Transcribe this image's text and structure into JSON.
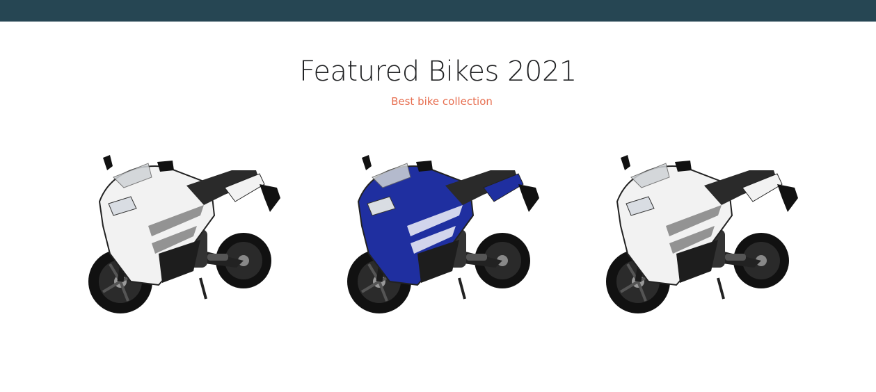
{
  "header": {
    "bar_color": "#264653"
  },
  "section": {
    "title": "Featured Bikes 2021",
    "subtitle": "Best bike collection",
    "subtitle_color": "#e76f51"
  },
  "bikes": [
    {
      "name": "bike-white",
      "accent": "#f2f2f2",
      "decal": "#7a7a7a"
    },
    {
      "name": "bike-blue",
      "accent": "#1f2fa0",
      "decal": "#ffffff"
    },
    {
      "name": "bike-white-2",
      "accent": "#f2f2f2",
      "decal": "#7a7a7a"
    }
  ]
}
